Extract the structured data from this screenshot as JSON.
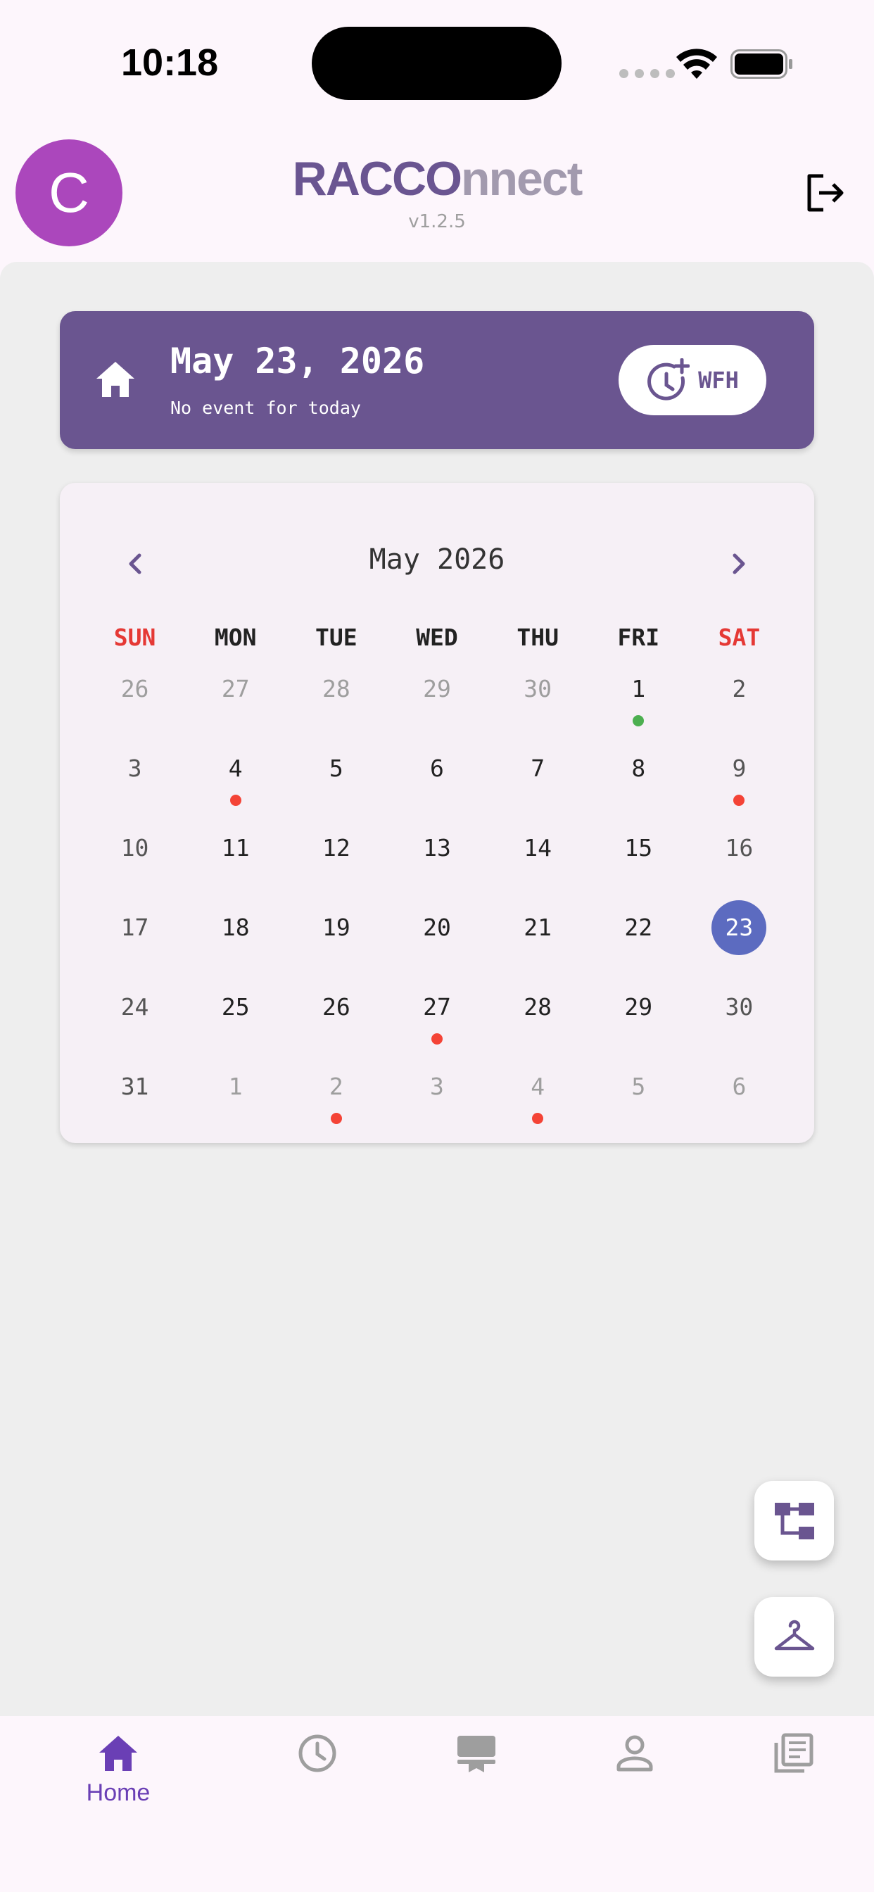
{
  "status_bar": {
    "time": "10:18"
  },
  "header": {
    "avatar_initial": "C",
    "logo_part1": "RACCO",
    "logo_part2": "nnect",
    "version": "v1.2.5"
  },
  "today": {
    "date": "May 23, 2026",
    "subtitle": "No event for today",
    "wfh_label": "WFH"
  },
  "calendar": {
    "month_title": "May 2026",
    "weekdays": [
      {
        "label": "SUN",
        "weekend": true
      },
      {
        "label": "MON",
        "weekend": false
      },
      {
        "label": "TUE",
        "weekend": false
      },
      {
        "label": "WED",
        "weekend": false
      },
      {
        "label": "THU",
        "weekend": false
      },
      {
        "label": "FRI",
        "weekend": false
      },
      {
        "label": "SAT",
        "weekend": true
      }
    ],
    "weeks": [
      [
        {
          "d": "26",
          "m": true
        },
        {
          "d": "27",
          "m": true
        },
        {
          "d": "28",
          "m": true
        },
        {
          "d": "29",
          "m": true
        },
        {
          "d": "30",
          "m": true
        },
        {
          "d": "1",
          "dot": "green"
        },
        {
          "d": "2",
          "w": true
        }
      ],
      [
        {
          "d": "3",
          "w": true
        },
        {
          "d": "4",
          "dot": "red"
        },
        {
          "d": "5"
        },
        {
          "d": "6"
        },
        {
          "d": "7"
        },
        {
          "d": "8"
        },
        {
          "d": "9",
          "w": true,
          "dot": "red"
        }
      ],
      [
        {
          "d": "10",
          "w": true
        },
        {
          "d": "11"
        },
        {
          "d": "12"
        },
        {
          "d": "13"
        },
        {
          "d": "14"
        },
        {
          "d": "15"
        },
        {
          "d": "16",
          "w": true
        }
      ],
      [
        {
          "d": "17",
          "w": true
        },
        {
          "d": "18"
        },
        {
          "d": "19"
        },
        {
          "d": "20"
        },
        {
          "d": "21"
        },
        {
          "d": "22"
        },
        {
          "d": "23",
          "w": true,
          "selected": true
        }
      ],
      [
        {
          "d": "24",
          "w": true
        },
        {
          "d": "25"
        },
        {
          "d": "26"
        },
        {
          "d": "27",
          "dot": "red"
        },
        {
          "d": "28"
        },
        {
          "d": "29"
        },
        {
          "d": "30",
          "w": true
        }
      ],
      [
        {
          "d": "31",
          "w": true
        },
        {
          "d": "1",
          "m": true
        },
        {
          "d": "2",
          "m": true,
          "dot": "red"
        },
        {
          "d": "3",
          "m": true
        },
        {
          "d": "4",
          "m": true,
          "dot": "red"
        },
        {
          "d": "5",
          "m": true
        },
        {
          "d": "6",
          "m": true
        }
      ]
    ]
  },
  "colors": {
    "accent": "#6a5590",
    "selected": "#5c6bc0",
    "event_red": "#f44336",
    "event_green": "#4caf50",
    "weekend_red": "#e53935"
  },
  "bottom_nav": {
    "items": [
      {
        "icon": "home-icon",
        "label": "Home",
        "active": true
      },
      {
        "icon": "clock-icon",
        "label": "",
        "active": false
      },
      {
        "icon": "desk-icon",
        "label": "",
        "active": false
      },
      {
        "icon": "person-icon",
        "label": "",
        "active": false
      },
      {
        "icon": "documents-icon",
        "label": "",
        "active": false
      }
    ]
  }
}
